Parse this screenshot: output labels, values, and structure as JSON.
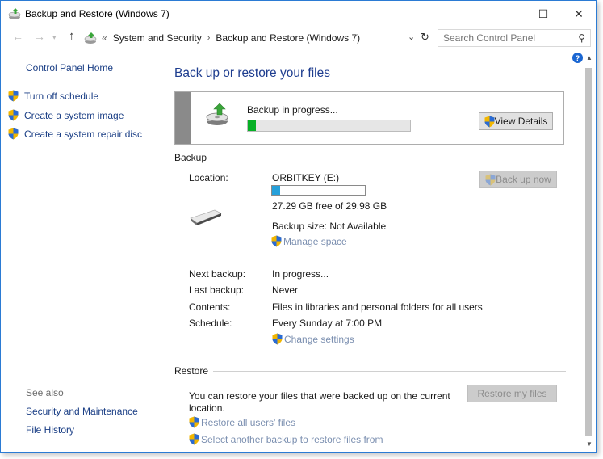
{
  "window": {
    "title": "Backup and Restore (Windows 7)",
    "controls": {
      "minimize": "—",
      "maximize": "☐",
      "close": "✕"
    }
  },
  "address_bar": {
    "overflow": "«",
    "crumbs": [
      "System and Security",
      "Backup and Restore (Windows 7)"
    ],
    "separator": "›",
    "search_placeholder": "Search Control Panel"
  },
  "left_pane": {
    "home": "Control Panel Home",
    "tasks": [
      "Turn off schedule",
      "Create a system image",
      "Create a system repair disc"
    ],
    "see_also_label": "See also",
    "see_also": [
      "Security and Maintenance",
      "File History"
    ]
  },
  "main": {
    "title": "Back up or restore your files",
    "progress": {
      "status": "Backup in progress...",
      "fraction": 0.05,
      "view_details": "View Details"
    },
    "backup": {
      "heading": "Backup",
      "location_label": "Location:",
      "location_value": "ORBITKEY (E:)",
      "used_fraction": 0.09,
      "free_text": "27.29 GB free of 29.98 GB",
      "size_text": "Backup size: Not Available",
      "manage_space": "Manage space",
      "back_up_now": "Back up now",
      "next_label": "Next backup:",
      "next_value": "In progress...",
      "last_label": "Last backup:",
      "last_value": "Never",
      "contents_label": "Contents:",
      "contents_value": "Files in libraries and personal folders for all users",
      "schedule_label": "Schedule:",
      "schedule_value": "Every Sunday at 7:00 PM",
      "change_settings": "Change settings"
    },
    "restore": {
      "heading": "Restore",
      "text": "You can restore your files that were backed up on the current location.",
      "restore_my_files": "Restore my files",
      "restore_all": "Restore all users' files",
      "select_another": "Select another backup to restore files from"
    }
  },
  "help_glyph": "?",
  "colors": {
    "link": "#1a3e85",
    "title": "#1e3d8f",
    "progress_green": "#06b025",
    "capacity_blue": "#26a0da",
    "disabled_link": "#7b8fb0"
  }
}
